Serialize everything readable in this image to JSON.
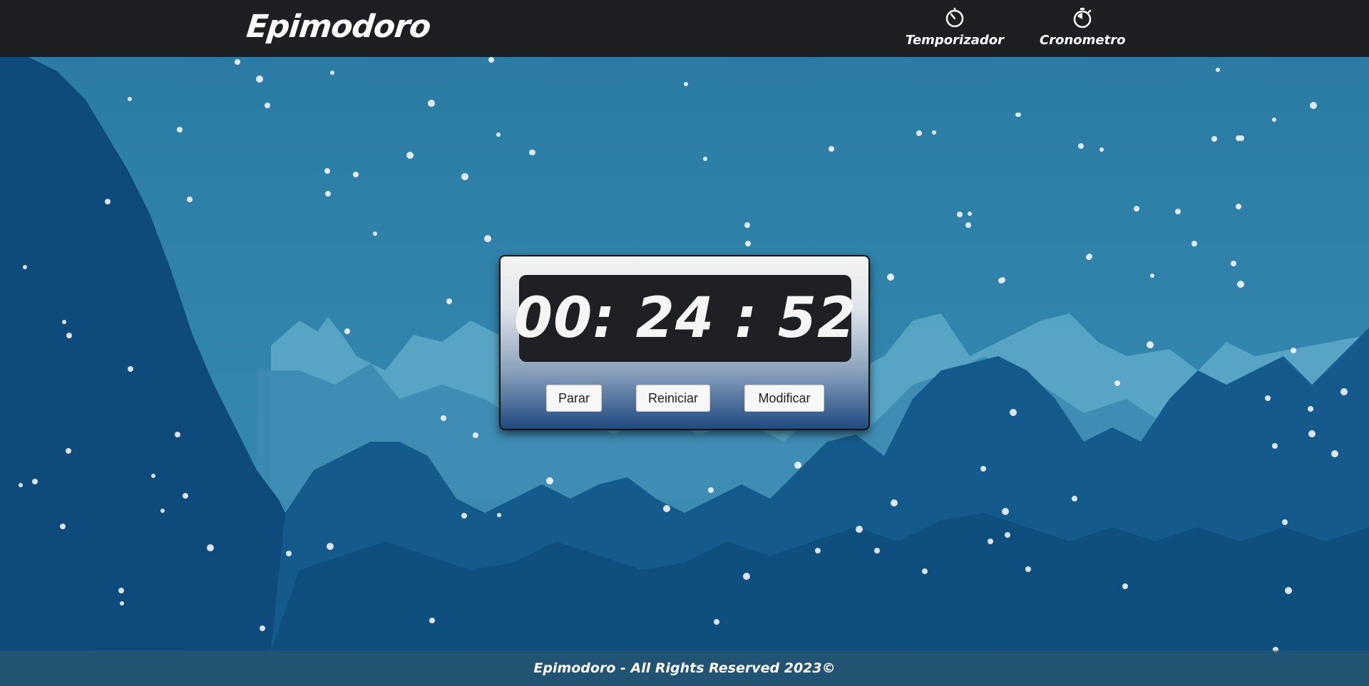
{
  "header": {
    "brand": "Epimodoro",
    "nav": [
      {
        "label": "Temporizador",
        "icon": "timer-icon"
      },
      {
        "label": "Cronometro",
        "icon": "stopwatch-icon"
      }
    ]
  },
  "timer": {
    "display": "00: 24 : 52",
    "buttons": {
      "stop": "Parar",
      "reset": "Reiniciar",
      "modify": "Modificar"
    }
  },
  "footer": {
    "text": "Epimodoro - All Rights Reserved 2023©"
  },
  "colors": {
    "topbar": "#1e1f23",
    "sky": "#2b7fa8",
    "mountain_light": "#5aa9c9",
    "mountain_dark": "#0c4a7c",
    "display_bg": "#1f2024"
  }
}
